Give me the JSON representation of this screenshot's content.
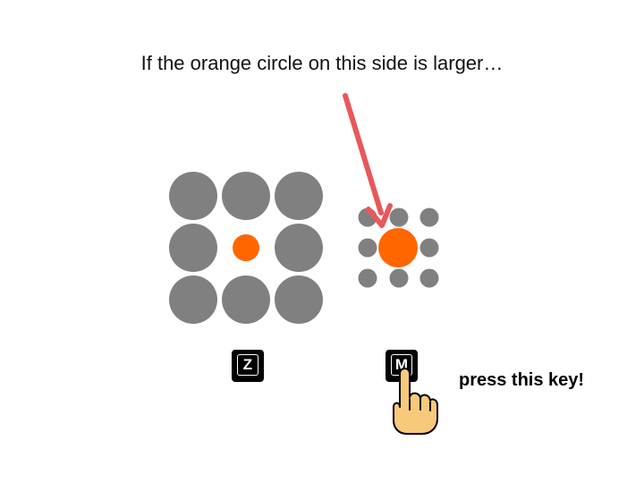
{
  "instruction": {
    "text": "If the orange circle on this side is larger…"
  },
  "keys": {
    "left": "Z",
    "right": "M"
  },
  "hint": {
    "text": "press this key!"
  },
  "colors": {
    "gray": "#808080",
    "orange": "#ff6600",
    "arrow": "#e8585a",
    "hand": "#f7c97a"
  },
  "icons": {
    "pointer": "pointing-hand-icon",
    "arrow": "down-arrow-icon"
  }
}
